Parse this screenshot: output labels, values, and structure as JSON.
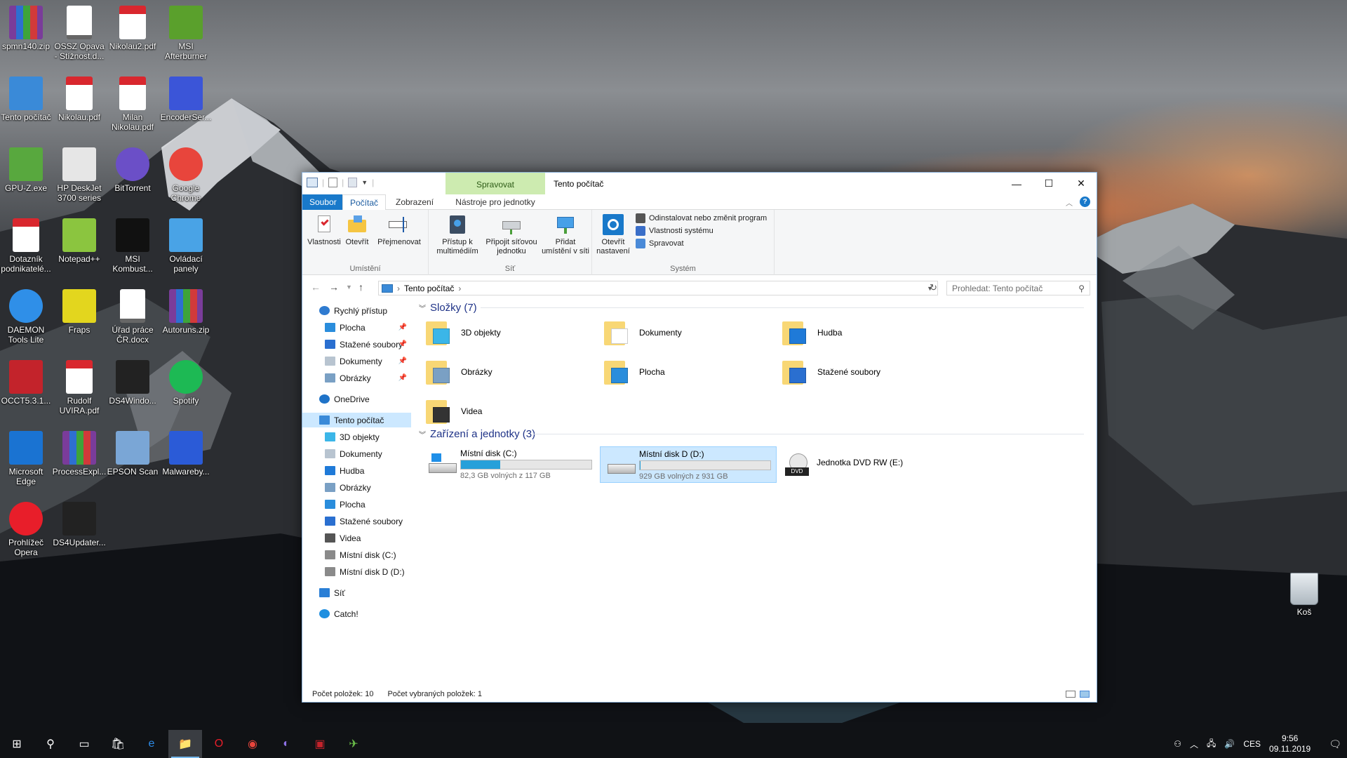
{
  "desktop": {
    "icons": [
      {
        "label": "spmn140.zip",
        "kind": "zip-icon",
        "color": "#7a3c9a"
      },
      {
        "label": "OSSZ Opava - Stížnost.d...",
        "kind": "docx-icon",
        "color": "#ffffff"
      },
      {
        "label": "Nikolau2.pdf",
        "kind": "pdf-icon",
        "color": "#d9272e"
      },
      {
        "label": "MSI Afterburner",
        "kind": "afterburner-icon",
        "color": "#5aa02c"
      },
      {
        "label": "Tento počítač",
        "kind": "computer-icon",
        "color": "#3a8ad8"
      },
      {
        "label": "Nikolau.pdf",
        "kind": "pdf-icon",
        "color": "#d9272e"
      },
      {
        "label": "Milan Nikolau.pdf",
        "kind": "pdf-icon",
        "color": "#d9272e"
      },
      {
        "label": "EncoderSer...",
        "kind": "encoder-icon",
        "color": "#3b55d8"
      },
      {
        "label": "GPU-Z.exe",
        "kind": "gpuz-icon",
        "color": "#58a83e"
      },
      {
        "label": "HP DeskJet 3700 series",
        "kind": "printer-icon",
        "color": "#e6e6e6"
      },
      {
        "label": "BitTorrent",
        "kind": "bittorrent-icon",
        "color": "#6b4fc7"
      },
      {
        "label": "Google Chrome",
        "kind": "chrome-icon",
        "color": "#e8453c"
      },
      {
        "label": "Dotazník podnikatelé...",
        "kind": "pdf-icon",
        "color": "#d9272e"
      },
      {
        "label": "Notepad++",
        "kind": "notepad-plus-icon",
        "color": "#8bc53f"
      },
      {
        "label": "MSI Kombust...",
        "kind": "kombustor-icon",
        "color": "#111111"
      },
      {
        "label": "Ovládací panely",
        "kind": "control-panel-icon",
        "color": "#49a3e6"
      },
      {
        "label": "DAEMON Tools Lite",
        "kind": "daemon-tools-icon",
        "color": "#2f8fe8"
      },
      {
        "label": "Fraps",
        "kind": "fraps-icon",
        "color": "#e3d61e"
      },
      {
        "label": "Úřad práce ČR.docx",
        "kind": "docx-icon",
        "color": "#ffffff"
      },
      {
        "label": "Autoruns.zip",
        "kind": "zip-icon",
        "color": "#7a3c9a"
      },
      {
        "label": "OCCT5.3.1...",
        "kind": "occt-icon",
        "color": "#c3232b"
      },
      {
        "label": "Rudolf UVIRA.pdf",
        "kind": "pdf-icon",
        "color": "#d9272e"
      },
      {
        "label": "DS4Windo...",
        "kind": "gamepad-icon",
        "color": "#222222"
      },
      {
        "label": "Spotify",
        "kind": "spotify-icon",
        "color": "#1db954"
      },
      {
        "label": "Microsoft Edge",
        "kind": "edge-icon",
        "color": "#1a73d2"
      },
      {
        "label": "ProcessExpl...",
        "kind": "zip-icon",
        "color": "#7a3c9a"
      },
      {
        "label": "EPSON Scan",
        "kind": "scanner-icon",
        "color": "#7aa6d6"
      },
      {
        "label": "Malwareby...",
        "kind": "malwarebytes-icon",
        "color": "#2b5bd7"
      },
      {
        "label": "Prohlížeč Opera",
        "kind": "opera-icon",
        "color": "#e81e2a"
      },
      {
        "label": "DS4Updater...",
        "kind": "gamepad-icon",
        "color": "#222222"
      }
    ],
    "recycle_bin": {
      "label": "Koš"
    }
  },
  "window": {
    "title": "Tento počítač",
    "context_tab": "Spravovat",
    "tabs": {
      "file": "Soubor",
      "computer": "Počítač",
      "view": "Zobrazení",
      "drive_tools": "Nástroje pro jednotky"
    },
    "ribbon": {
      "location": {
        "label": "Umístění",
        "properties": "Vlastnosti",
        "open": "Otevřít",
        "rename": "Přejmenovat"
      },
      "network": {
        "label": "Síť",
        "media": "Přístup k multimédiím",
        "map_drive": "Připojit síťovou jednotku",
        "add_location": "Přidat umístění v síti"
      },
      "system": {
        "label": "Systém",
        "open_settings": "Otevřít nastavení",
        "uninstall": "Odinstalovat nebo změnit program",
        "sys_props": "Vlastnosti systému",
        "manage": "Spravovat"
      }
    },
    "address": {
      "path": "Tento počítač",
      "search_placeholder": "Prohledat: Tento počítač"
    },
    "sidebar": [
      {
        "label": "Rychlý přístup",
        "icon": "star-icon",
        "color": "#2f7bd0",
        "indent": 0,
        "pinned": false
      },
      {
        "label": "Plocha",
        "icon": "desktop-folder-icon",
        "color": "#2a8ddc",
        "indent": 1,
        "pinned": true
      },
      {
        "label": "Stažené soubory",
        "icon": "download-icon",
        "color": "#2a6fd0",
        "indent": 1,
        "pinned": true
      },
      {
        "label": "Dokumenty",
        "icon": "documents-icon",
        "color": "#b8c4d0",
        "indent": 1,
        "pinned": true
      },
      {
        "label": "Obrázky",
        "icon": "pictures-icon",
        "color": "#7aa0c4",
        "indent": 1,
        "pinned": true
      },
      {
        "label": "OneDrive",
        "icon": "cloud-icon",
        "color": "#1f73c8",
        "indent": 0,
        "pinned": false
      },
      {
        "label": "Tento počítač",
        "icon": "computer-icon",
        "color": "#3a8ad8",
        "indent": 0,
        "pinned": false,
        "selected": true
      },
      {
        "label": "3D objekty",
        "icon": "3d-objects-icon",
        "color": "#3bb6e8",
        "indent": 1,
        "pinned": false
      },
      {
        "label": "Dokumenty",
        "icon": "documents-icon",
        "color": "#b8c4d0",
        "indent": 1,
        "pinned": false
      },
      {
        "label": "Hudba",
        "icon": "music-icon",
        "color": "#1f7ad8",
        "indent": 1,
        "pinned": false
      },
      {
        "label": "Obrázky",
        "icon": "pictures-icon",
        "color": "#7aa0c4",
        "indent": 1,
        "pinned": false
      },
      {
        "label": "Plocha",
        "icon": "desktop-folder-icon",
        "color": "#2a8ddc",
        "indent": 1,
        "pinned": false
      },
      {
        "label": "Stažené soubory",
        "icon": "download-icon",
        "color": "#2a6fd0",
        "indent": 1,
        "pinned": false
      },
      {
        "label": "Videa",
        "icon": "video-icon",
        "color": "#555555",
        "indent": 1,
        "pinned": false
      },
      {
        "label": "Místní disk (C:)",
        "icon": "drive-icon",
        "color": "#8a8a8a",
        "indent": 1,
        "pinned": false
      },
      {
        "label": "Místní disk D (D:)",
        "icon": "drive-icon",
        "color": "#8a8a8a",
        "indent": 1,
        "pinned": false
      },
      {
        "label": "Síť",
        "icon": "network-icon",
        "color": "#2a7fd6",
        "indent": 0,
        "pinned": false
      },
      {
        "label": "Catch!",
        "icon": "catch-icon",
        "color": "#1f8fe0",
        "indent": 0,
        "pinned": false
      }
    ],
    "folders_header": "Složky (7)",
    "folders": [
      {
        "label": "3D objekty",
        "icon": "3d-objects-icon",
        "accent": "#3bb6e8"
      },
      {
        "label": "Dokumenty",
        "icon": "documents-icon",
        "accent": "#ffffff"
      },
      {
        "label": "Hudba",
        "icon": "music-icon",
        "accent": "#1f7ad8"
      },
      {
        "label": "Obrázky",
        "icon": "pictures-icon",
        "accent": "#7aa0c4"
      },
      {
        "label": "Plocha",
        "icon": "desktop-folder-icon",
        "accent": "#2a8ddc"
      },
      {
        "label": "Stažené soubory",
        "icon": "download-icon",
        "accent": "#2a6fd0"
      },
      {
        "label": "Videa",
        "icon": "video-icon",
        "accent": "#333333"
      }
    ],
    "devices_header": "Zařízení a jednotky (3)",
    "devices": [
      {
        "label": "Místní disk (C:)",
        "free": "82,3 GB volných z 117 GB",
        "used_fraction": 0.3,
        "icon": "windows-drive-icon"
      },
      {
        "label": "Místní disk D (D:)",
        "free": "929 GB volných z 931 GB",
        "used_fraction": 0.002,
        "icon": "drive-icon",
        "selected": true
      },
      {
        "label": "Jednotka DVD RW (E:)",
        "free": "",
        "icon": "dvd-drive-icon"
      }
    ],
    "status": {
      "count": "Počet položek: 10",
      "selected": "Počet vybraných položek: 1"
    }
  },
  "taskbar": {
    "items": [
      {
        "name": "start-button",
        "glyph": "⊞",
        "color": "#ffffff"
      },
      {
        "name": "search-button",
        "glyph": "⚲",
        "color": "#ffffff"
      },
      {
        "name": "task-view-button",
        "glyph": "▭",
        "color": "#ffffff"
      },
      {
        "name": "taskbar-store",
        "glyph": "🛍",
        "color": "#ffffff"
      },
      {
        "name": "taskbar-edge",
        "glyph": "e",
        "color": "#2c8ae6"
      },
      {
        "name": "taskbar-explorer",
        "glyph": "📁",
        "color": "#f2c94c",
        "open": true
      },
      {
        "name": "taskbar-opera",
        "glyph": "O",
        "color": "#e81e2a"
      },
      {
        "name": "taskbar-chrome",
        "glyph": "◉",
        "color": "#e8453c"
      },
      {
        "name": "taskbar-bittorrent",
        "glyph": "◐",
        "color": "#8e72e6"
      },
      {
        "name": "taskbar-occt",
        "glyph": "▣",
        "color": "#c3232b"
      },
      {
        "name": "taskbar-afterburner",
        "glyph": "✈",
        "color": "#6bc04a"
      }
    ],
    "lang": "CES",
    "time": "9:56",
    "date": "09.11.2019"
  }
}
